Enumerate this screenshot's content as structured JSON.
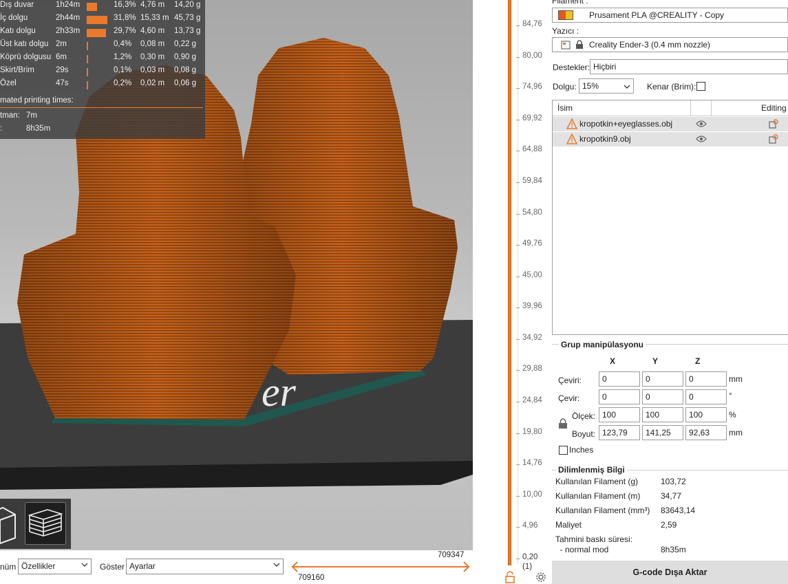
{
  "stats": {
    "rows": [
      {
        "name": "Dış duvar",
        "time": "1h24m",
        "bar": 0.163,
        "pct": "16,3%",
        "m": "4,76 m",
        "g": "14,20 g"
      },
      {
        "name": "İç dolgu",
        "time": "2h44m",
        "bar": 0.318,
        "pct": "31,8%",
        "m": "15,33 m",
        "g": "45,73 g"
      },
      {
        "name": "Katı dolgu",
        "time": "2h33m",
        "bar": 0.297,
        "pct": "29,7%",
        "m": "4,60 m",
        "g": "13,73 g"
      },
      {
        "name": "Üst katı dolgu",
        "time": "2m",
        "bar": 0.004,
        "pct": "0,4%",
        "m": "0,08 m",
        "g": "0,22 g"
      },
      {
        "name": "Köprü dolgusu",
        "time": "6m",
        "bar": 0.012,
        "pct": "1,2%",
        "m": "0,30 m",
        "g": "0,90 g"
      },
      {
        "name": "Skirt/Brim",
        "time": "29s",
        "bar": 0.001,
        "pct": "0,1%",
        "m": "0,03 m",
        "g": "0,08 g"
      },
      {
        "name": "Özel",
        "time": "47s",
        "bar": 0.002,
        "pct": "0,2%",
        "m": "0,02 m",
        "g": "0,06 g"
      }
    ],
    "estimated_title": "mated printing times:",
    "est": [
      {
        "label": "tman:",
        "value": "7m"
      },
      {
        "label": ":",
        "value": "8h35m"
      }
    ]
  },
  "bottom": {
    "view_label": "nüm",
    "view_value": "Özellikler",
    "show_label": "Göster",
    "show_value": "Ayarlar",
    "h_top": "709347",
    "h_bottom": "709160"
  },
  "vslider": {
    "labels": [
      "84,76",
      "80,00",
      "74,96",
      "69,92",
      "64,88",
      "59,84",
      "54,80",
      "49,76",
      "45,00",
      "39,96",
      "34,92",
      "29,88",
      "24,84",
      "19,80",
      "14,76",
      "10,00",
      "4,96",
      "0,20"
    ],
    "bottom_index": "(1)"
  },
  "sidebar": {
    "filament_label": "Filament :",
    "filament_value": "Prusament PLA @CREALITY - Copy",
    "printer_label": "Yazıcı :",
    "printer_value": "Creality Ender-3 (0.4 mm nozzle)",
    "supports_label": "Destekler:",
    "supports_value": "Hiçbiri",
    "infill_label": "Dolgu:",
    "infill_value": "15%",
    "brim_label": "Kenar (Brim):",
    "list_header_name": "İsim",
    "list_header_editing": "Editing",
    "objects": [
      "kropotkin+eyeglasses.obj",
      "kropotkin9.obj"
    ],
    "group_title": "Grup manipülasyonu",
    "axes": [
      "X",
      "Y",
      "Z"
    ],
    "rows": [
      {
        "label": "Çeviri:",
        "values": [
          "0",
          "0",
          "0"
        ],
        "unit": "mm"
      },
      {
        "label": "Çevir:",
        "values": [
          "0",
          "0",
          "0"
        ],
        "unit": "°"
      },
      {
        "label": "Ölçek:",
        "values": [
          "100",
          "100",
          "100"
        ],
        "unit": "%"
      },
      {
        "label": "Boyut:",
        "values": [
          "123,79",
          "141,25",
          "92,63"
        ],
        "unit": "mm"
      }
    ],
    "inches_label": "Inches",
    "info_title": "Dilimlenmiş Bilgi",
    "info": [
      {
        "label": "Kullanılan Filament (g)",
        "value": "103,72"
      },
      {
        "label": "Kullanılan Filament (m)",
        "value": "34,77"
      },
      {
        "label": "Kullanılan Filament (mm³)",
        "value": "83643,14"
      },
      {
        "label": "Maliyet",
        "value": "2,59"
      },
      {
        "label": "Tahmini baskı süresi:",
        "value": ""
      },
      {
        "label": "  - normal mod",
        "value": "8h35m"
      }
    ],
    "export_label": "G-code Dışa Aktar"
  },
  "colors": {
    "accent": "#e97a2c",
    "model": "#c8651f",
    "bed": "#3a3a3a"
  }
}
